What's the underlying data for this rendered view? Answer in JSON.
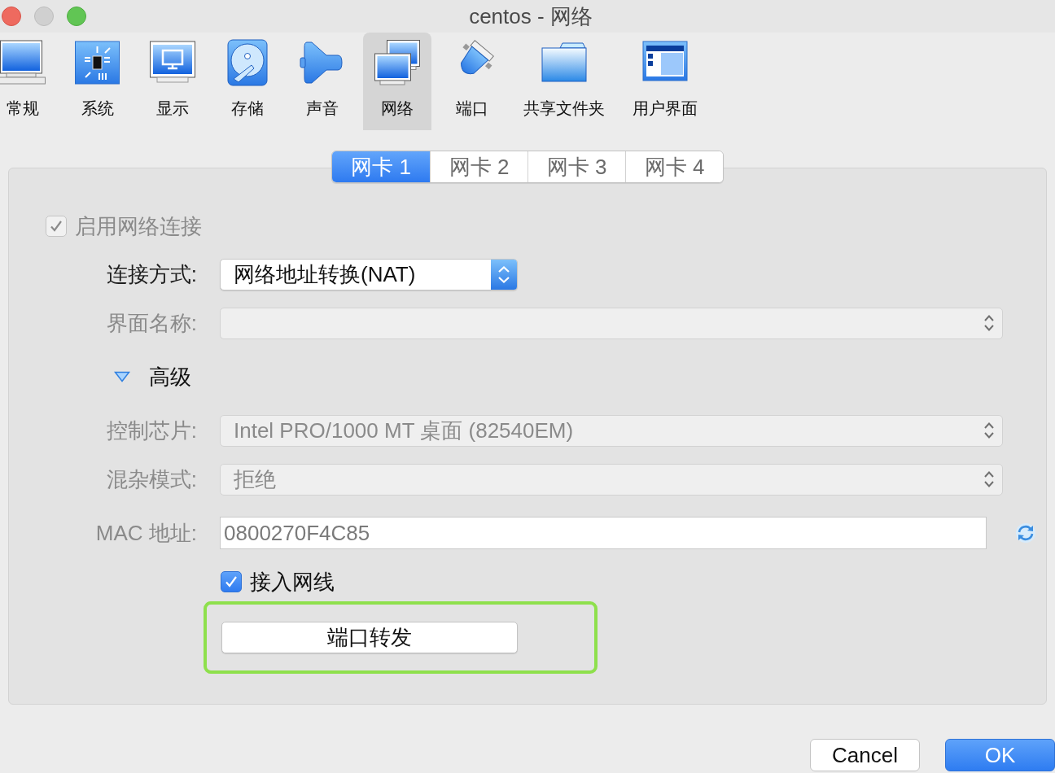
{
  "window": {
    "title": "centos - 网络"
  },
  "toolbar": [
    {
      "kind": "general",
      "label": "常规",
      "selected": false
    },
    {
      "kind": "system",
      "label": "系统",
      "selected": false
    },
    {
      "kind": "display",
      "label": "显示",
      "selected": false
    },
    {
      "kind": "storage",
      "label": "存储",
      "selected": false
    },
    {
      "kind": "audio",
      "label": "声音",
      "selected": false
    },
    {
      "kind": "network",
      "label": "网络",
      "selected": true
    },
    {
      "kind": "serial",
      "label": "端口",
      "selected": false
    },
    {
      "kind": "shared-folders",
      "label": "共享文件夹",
      "selected": false
    },
    {
      "kind": "user-interface",
      "label": "用户界面",
      "selected": false
    }
  ],
  "adapter_tabs": [
    {
      "label": "网卡 1",
      "selected": true
    },
    {
      "label": "网卡 2",
      "selected": false
    },
    {
      "label": "网卡 3",
      "selected": false
    },
    {
      "label": "网卡 4",
      "selected": false
    }
  ],
  "enable_adapter": {
    "label": "启用网络连接",
    "checked": true,
    "disabled": true
  },
  "rows": [
    {
      "kind": "select",
      "label": "连接方式:",
      "value": "网络地址转换(NAT)",
      "disabled": false
    },
    {
      "kind": "select",
      "label": "界面名称:",
      "disabled": true
    },
    {
      "kind": "disclosure",
      "label": "高级",
      "expanded": true
    },
    {
      "kind": "select",
      "label": "控制芯片:",
      "value": "Intel PRO/1000 MT 桌面 (82540EM)",
      "disabled": true
    },
    {
      "kind": "select",
      "label": "混杂模式:",
      "value": "拒绝",
      "disabled": true
    },
    {
      "kind": "text",
      "label": "MAC 地址:",
      "value": "0800270F4C85",
      "disabled": true
    },
    {
      "kind": "checkbox",
      "label": "接入网线",
      "checked": true,
      "disabled": false
    },
    {
      "kind": "button",
      "label": "端口转发",
      "highlighted": true
    }
  ],
  "buttons": [
    {
      "kind": "cancel",
      "label": "Cancel"
    },
    {
      "kind": "default",
      "label": "OK"
    }
  ]
}
